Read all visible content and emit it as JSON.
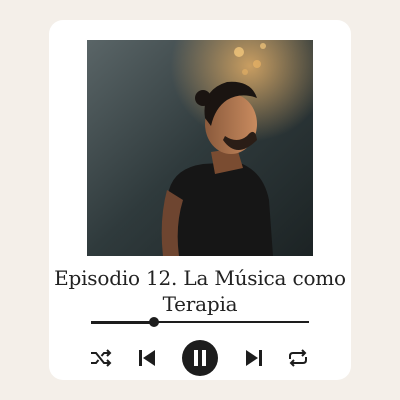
{
  "episode": {
    "title": "Episodio 12. La Música como Terapia"
  },
  "player": {
    "progress_fraction": 0.29,
    "state": "playing"
  },
  "controls": {
    "shuffle_icon": "shuffle-icon",
    "previous_icon": "skip-previous-icon",
    "pause_icon": "pause-icon",
    "next_icon": "skip-next-icon",
    "repeat_icon": "repeat-icon"
  },
  "colors": {
    "background": "#f4efe9",
    "card": "#ffffff",
    "accent": "#1d1d1d"
  }
}
